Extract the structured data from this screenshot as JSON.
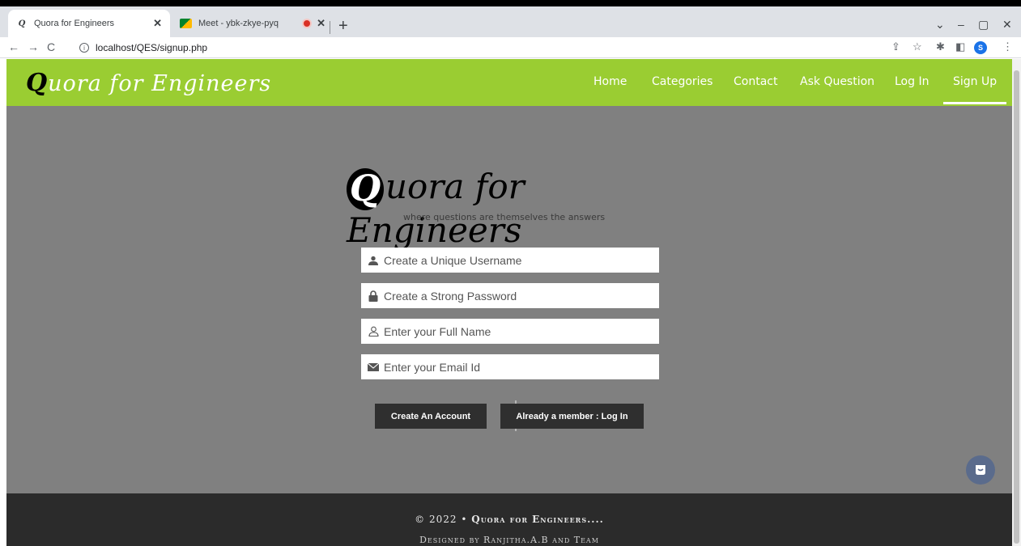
{
  "browser": {
    "tabs": [
      {
        "title": "Quora for Engineers",
        "favicon": "quora-q",
        "active": true
      },
      {
        "title": "Meet - ybk-zkye-pyq",
        "favicon": "google-meet",
        "recording": true,
        "active": false
      }
    ],
    "url": "localhost/QES/signup.php",
    "profile_initial": "S"
  },
  "navbar": {
    "brand_q": "Q",
    "brand_rest": "uora for Engineers",
    "links": [
      "Home",
      "Categories",
      "Contact",
      "Ask Question",
      "Log In",
      "Sign Up"
    ],
    "active_link": "Sign Up",
    "bg_color": "#9acd32"
  },
  "hero": {
    "logo_q": "Q",
    "logo_rest": "uora for Engineers",
    "tagline": "where questions are themselves the answers"
  },
  "form": {
    "username_placeholder": "Create a Unique Username",
    "password_placeholder": "Create a Strong Password",
    "fullname_placeholder": "Enter your Full Name",
    "email_placeholder": "Enter your Email Id",
    "create_button": "Create An Account",
    "login_button": "Already a member : Log In"
  },
  "footer": {
    "copyright_prefix": "© 2022 •",
    "site_name": "Quora for Engineers....",
    "designed_by": "Designed by Ranjitha.A.B and Team"
  }
}
